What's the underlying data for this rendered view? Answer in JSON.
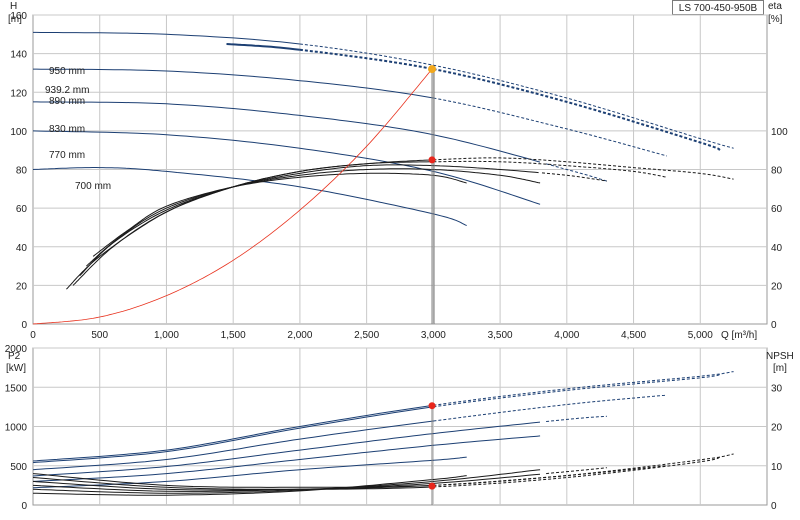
{
  "model": "LS 700-450-950B",
  "colors": {
    "head": "#1c3f73",
    "eta": "#1a1a1a",
    "system": "#e8321e",
    "duty_point": "#e8261c",
    "duty_point_alt": "#f2a81d",
    "grid": "#c8c8c8"
  },
  "chart_data": [
    {
      "type": "line",
      "name": "head-and-efficiency",
      "xlabel": "Q [m³/h]",
      "xlim": [
        0,
        5500
      ],
      "x_ticks": [
        0,
        500,
        1000,
        1500,
        2000,
        2500,
        3000,
        3500,
        4000,
        4500,
        5000
      ],
      "x_tick_labels": [
        "0",
        "500",
        "1,000",
        "1,500",
        "2,000",
        "2,500",
        "3,000",
        "3,500",
        "4,000",
        "4,500",
        "5,000"
      ],
      "y_axis_left": {
        "label_line1": "H",
        "label_line2": "[m]",
        "lim": [
          0,
          160
        ],
        "ticks": [
          0,
          20,
          40,
          60,
          80,
          100,
          120,
          140,
          160
        ]
      },
      "y_axis_right": {
        "label_line1": "eta",
        "label_line2": "[%]",
        "lim": [
          0,
          160
        ],
        "ticks": [
          0,
          20,
          40,
          60,
          80,
          100
        ]
      },
      "grid": true,
      "head_curves": [
        {
          "label": "950 mm",
          "x": [
            0,
            1000,
            2000,
            3000,
            4000,
            5000,
            5250
          ],
          "y": [
            151,
            150,
            145,
            134,
            117,
            96,
            91
          ],
          "solid_until": 2000
        },
        {
          "label": "939.2 mm",
          "x": [
            1450,
            2000,
            3000,
            4000,
            5000,
            5150
          ],
          "y": [
            145,
            142,
            132,
            115,
            94,
            90
          ],
          "solid_until": 2000,
          "bold": true
        },
        {
          "label": "890 mm",
          "x": [
            0,
            1000,
            2000,
            3000,
            4000,
            4750
          ],
          "y": [
            132,
            131,
            126,
            117,
            101,
            87
          ],
          "solid_until": 3000
        },
        {
          "label": "830 mm",
          "x": [
            0,
            1000,
            2000,
            3000,
            4000,
            4300
          ],
          "y": [
            115,
            114,
            108,
            98,
            80,
            74
          ],
          "solid_until": 3800
        },
        {
          "label": "770 mm",
          "x": [
            0,
            1000,
            2000,
            3000,
            3800
          ],
          "y": [
            100,
            98,
            91,
            79,
            62
          ],
          "solid_until": 3800
        },
        {
          "label": "700 mm",
          "x": [
            0,
            500,
            1000,
            2000,
            3000,
            3250
          ],
          "y": [
            80,
            81,
            79,
            71,
            57,
            51
          ],
          "solid_until": 3250
        }
      ],
      "efficiency_curves": [
        {
          "x": [
            250,
            500,
            1000,
            1500,
            2000,
            2500,
            3000,
            3500,
            4000,
            4500,
            5000,
            5250
          ],
          "y": [
            18,
            35,
            58,
            71,
            79,
            83,
            85,
            86,
            84,
            81,
            78,
            75
          ],
          "solid_until": 3000
        },
        {
          "x": [
            300,
            600,
            1000,
            1500,
            2000,
            2500,
            3000,
            3500,
            4000,
            4500,
            4750
          ],
          "y": [
            20,
            40,
            58,
            71,
            79,
            83,
            84,
            84,
            82,
            79,
            76
          ],
          "solid_until": 3000
        },
        {
          "x": [
            350,
            600,
            1000,
            1500,
            2000,
            2500,
            3000,
            3500,
            4000,
            4300
          ],
          "y": [
            25,
            42,
            59,
            71,
            78,
            82,
            82,
            80,
            77,
            74
          ],
          "solid_until": 3800
        },
        {
          "x": [
            400,
            650,
            1000,
            1500,
            2000,
            2500,
            3000,
            3500,
            3800
          ],
          "y": [
            30,
            45,
            60,
            71,
            77,
            80,
            80,
            77,
            73
          ],
          "solid_until": 3800
        },
        {
          "x": [
            450,
            700,
            1000,
            1500,
            2000,
            2500,
            3000,
            3250
          ],
          "y": [
            35,
            48,
            61,
            71,
            76,
            78,
            77,
            73
          ],
          "solid_until": 3250
        }
      ],
      "system_curve": {
        "x": [
          0,
          500,
          1000,
          1500,
          2000,
          2500,
          2990
        ],
        "y": [
          0,
          3.6,
          14.7,
          33,
          59,
          92,
          132
        ]
      },
      "duty_point": {
        "q": 2990,
        "h": 132,
        "eta": 85
      },
      "curve_labels": [
        "950 mm",
        "939.2 mm",
        "890 mm",
        "830 mm",
        "770 mm",
        "700 mm"
      ]
    },
    {
      "type": "line",
      "name": "power-and-npsh",
      "xlim": [
        0,
        5500
      ],
      "y_axis_left": {
        "label_line1": "P2",
        "label_line2": "[kW]",
        "lim": [
          0,
          2000
        ],
        "ticks": [
          0,
          500,
          1000,
          1500,
          2000
        ]
      },
      "y_axis_right": {
        "label_line1": "NPSH",
        "label_line2": "[m]",
        "lim": [
          0,
          40
        ],
        "ticks": [
          0,
          10,
          20,
          30
        ]
      },
      "grid": true,
      "power_curves": [
        {
          "x": [
            0,
            1000,
            2000,
            3000,
            4000,
            5000,
            5250
          ],
          "y": [
            560,
            700,
            1000,
            1270,
            1480,
            1640,
            1700
          ],
          "solid_until": 3000
        },
        {
          "x": [
            0,
            1000,
            2000,
            3000,
            4000,
            5000,
            5150
          ],
          "y": [
            540,
            680,
            980,
            1250,
            1460,
            1620,
            1670
          ],
          "solid_until": 3000
        },
        {
          "x": [
            0,
            1000,
            2000,
            3000,
            4000,
            4750
          ],
          "y": [
            450,
            580,
            840,
            1070,
            1280,
            1400
          ],
          "solid_until": 3000
        },
        {
          "x": [
            0,
            1000,
            2000,
            3000,
            4000,
            4300
          ],
          "y": [
            370,
            490,
            700,
            910,
            1090,
            1130
          ],
          "solid_until": 3800
        },
        {
          "x": [
            0,
            1000,
            2000,
            3000,
            3800
          ],
          "y": [
            300,
            400,
            580,
            760,
            880
          ],
          "solid_until": 3800
        },
        {
          "x": [
            0,
            1000,
            2000,
            3000,
            3250
          ],
          "y": [
            220,
            300,
            450,
            570,
            610
          ],
          "solid_until": 3250
        }
      ],
      "npsh_curves": [
        {
          "x": [
            0,
            1000,
            2000,
            3000,
            4000,
            5000,
            5250
          ],
          "y": [
            8,
            5,
            4.5,
            5,
            7.5,
            11.5,
            13
          ],
          "solid_until": 3000
        },
        {
          "x": [
            0,
            1000,
            2000,
            3000,
            4000,
            5000,
            5150
          ],
          "y": [
            7,
            4.5,
            4,
            4.6,
            7,
            11,
            12.5
          ],
          "solid_until": 3000
        },
        {
          "x": [
            0,
            1000,
            2000,
            3000,
            4000,
            4750
          ],
          "y": [
            6,
            4,
            4,
            5,
            7.5,
            10
          ],
          "solid_until": 3000
        },
        {
          "x": [
            0,
            1000,
            2000,
            3000,
            4000,
            4300
          ],
          "y": [
            5,
            3.5,
            4,
            5.5,
            8.5,
            9.5
          ],
          "solid_until": 3800
        },
        {
          "x": [
            0,
            1000,
            2000,
            3000,
            3800
          ],
          "y": [
            4,
            3,
            3.8,
            6,
            9
          ],
          "solid_until": 3800
        },
        {
          "x": [
            0,
            1000,
            2000,
            3000,
            3250
          ],
          "y": [
            3,
            2.5,
            3.6,
            6.5,
            7.5
          ],
          "solid_until": 3250
        }
      ],
      "duty_point": {
        "q": 2990,
        "p2": 1265,
        "npsh": 4.8
      }
    }
  ]
}
